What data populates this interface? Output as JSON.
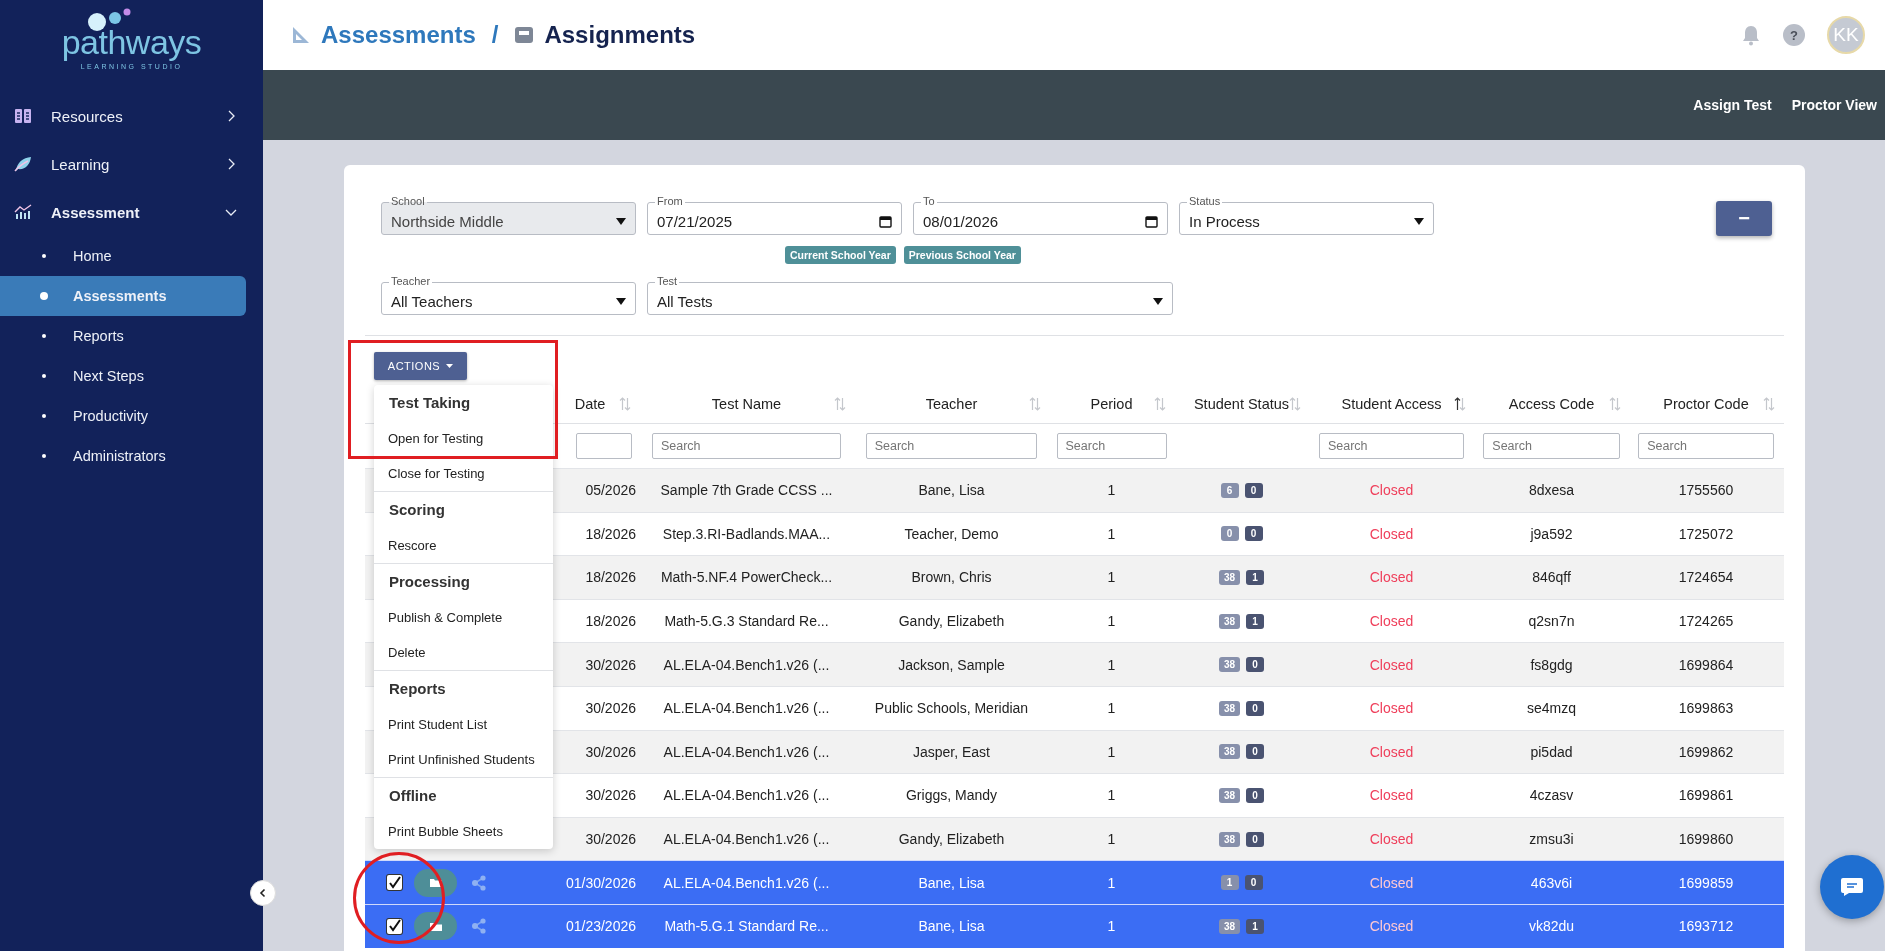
{
  "sidebar": {
    "logo": {
      "name": "pathways",
      "tagline": "LEARNING STUDIO"
    },
    "items": [
      {
        "label": "Resources",
        "kind": "book",
        "expanded": false
      },
      {
        "label": "Learning",
        "kind": "leaf",
        "expanded": false
      },
      {
        "label": "Assessment",
        "kind": "chart",
        "expanded": true,
        "children": [
          {
            "label": "Home",
            "selected": false
          },
          {
            "label": "Assessments",
            "selected": true
          },
          {
            "label": "Reports",
            "selected": false
          },
          {
            "label": "Next Steps",
            "selected": false
          },
          {
            "label": "Productivity",
            "selected": false
          },
          {
            "label": "Administrators",
            "selected": false
          }
        ]
      }
    ]
  },
  "header": {
    "breadcrumb": [
      {
        "label": "Assessments",
        "kind": "link"
      },
      {
        "label": "Assignments",
        "kind": "current"
      }
    ],
    "separator": "/",
    "help": "?",
    "avatar": "KK"
  },
  "toolbar": {
    "links": [
      "Assign Test",
      "Proctor View"
    ]
  },
  "filters": {
    "row_1": [
      {
        "label": "School",
        "value": "Northside Middle",
        "kind": "select",
        "disabled": true
      },
      {
        "label": "From",
        "value": "07/21/2025",
        "kind": "date",
        "disabled": false
      },
      {
        "label": "To",
        "value": "08/01/2026",
        "kind": "date",
        "disabled": false
      },
      {
        "label": "Status",
        "value": "In Process",
        "kind": "select",
        "disabled": false
      }
    ],
    "chips": [
      "Current School Year",
      "Previous School Year"
    ],
    "row_2": [
      {
        "label": "Teacher",
        "value": "All Teachers",
        "kind": "select",
        "disabled": false
      },
      {
        "label": "Test",
        "value": "All Tests",
        "kind": "select",
        "disabled": false
      }
    ],
    "collapse_button": "−"
  },
  "actions_menu": {
    "button": "ACTIONS",
    "groups": [
      {
        "title": "Test Taking",
        "items": [
          "Open for Testing",
          "Close for Testing"
        ]
      },
      {
        "title": "Scoring",
        "items": [
          "Rescore"
        ]
      },
      {
        "title": "Processing",
        "items": [
          "Publish & Complete",
          "Delete"
        ]
      },
      {
        "title": "Reports",
        "items": [
          "Print Student List",
          "Print Unfinished Students"
        ]
      },
      {
        "title": "Offline",
        "items": [
          "Print Bubble Sheets"
        ]
      }
    ]
  },
  "table": {
    "columns": [
      {
        "label": "Date",
        "sorted": false,
        "has_search": true
      },
      {
        "label": "Test Name",
        "sorted": false,
        "has_search": true,
        "placeholder": "Search"
      },
      {
        "label": "Teacher",
        "sorted": false,
        "has_search": true,
        "placeholder": "Search"
      },
      {
        "label": "Period",
        "sorted": false,
        "has_search": true,
        "placeholder": "Search"
      },
      {
        "label": "Student Status",
        "sorted": false,
        "has_search": false
      },
      {
        "label": "Student Access",
        "sorted": true,
        "has_search": true,
        "placeholder": "Search"
      },
      {
        "label": "Access Code",
        "sorted": false,
        "has_search": true,
        "placeholder": "Search"
      },
      {
        "label": "Proctor Code",
        "sorted": false,
        "has_search": true,
        "placeholder": "Search"
      }
    ],
    "rows": [
      {
        "selected": false,
        "date": "05/2026",
        "test_name": "Sample 7th Grade CCSS ...",
        "teacher": "Bane, Lisa",
        "period": "1",
        "counts": [
          "6",
          "0"
        ],
        "access": "Closed",
        "access_code": "8dxesa",
        "proctor_code": "1755560"
      },
      {
        "selected": false,
        "date": "18/2026",
        "test_name": "Step.3.RI-Badlands.MAA...",
        "teacher": "Teacher, Demo",
        "period": "1",
        "counts": [
          "0",
          "0"
        ],
        "access": "Closed",
        "access_code": "j9a592",
        "proctor_code": "1725072"
      },
      {
        "selected": false,
        "date": "18/2026",
        "test_name": "Math-5.NF.4 PowerCheck...",
        "teacher": "Brown, Chris",
        "period": "1",
        "counts": [
          "38",
          "1"
        ],
        "access": "Closed",
        "access_code": "846qff",
        "proctor_code": "1724654"
      },
      {
        "selected": false,
        "date": "18/2026",
        "test_name": "Math-5.G.3 Standard Re...",
        "teacher": "Gandy, Elizabeth",
        "period": "1",
        "counts": [
          "38",
          "1"
        ],
        "access": "Closed",
        "access_code": "q2sn7n",
        "proctor_code": "1724265"
      },
      {
        "selected": false,
        "date": "30/2026",
        "test_name": "AL.ELA-04.Bench1.v26 (...",
        "teacher": "Jackson, Sample",
        "period": "1",
        "counts": [
          "38",
          "0"
        ],
        "access": "Closed",
        "access_code": "fs8gdg",
        "proctor_code": "1699864"
      },
      {
        "selected": false,
        "date": "30/2026",
        "test_name": "AL.ELA-04.Bench1.v26 (...",
        "teacher": "Public Schools, Meridian",
        "period": "1",
        "counts": [
          "38",
          "0"
        ],
        "access": "Closed",
        "access_code": "se4mzq",
        "proctor_code": "1699863"
      },
      {
        "selected": false,
        "date": "30/2026",
        "test_name": "AL.ELA-04.Bench1.v26 (...",
        "teacher": "Jasper, East",
        "period": "1",
        "counts": [
          "38",
          "0"
        ],
        "access": "Closed",
        "access_code": "pi5dad",
        "proctor_code": "1699862"
      },
      {
        "selected": false,
        "date": "30/2026",
        "test_name": "AL.ELA-04.Bench1.v26 (...",
        "teacher": "Griggs, Mandy",
        "period": "1",
        "counts": [
          "38",
          "0"
        ],
        "access": "Closed",
        "access_code": "4czasv",
        "proctor_code": "1699861"
      },
      {
        "selected": false,
        "date": "30/2026",
        "test_name": "AL.ELA-04.Bench1.v26 (...",
        "teacher": "Gandy, Elizabeth",
        "period": "1",
        "counts": [
          "38",
          "0"
        ],
        "access": "Closed",
        "access_code": "zmsu3i",
        "proctor_code": "1699860"
      },
      {
        "selected": true,
        "checked": true,
        "date": "01/30/2026",
        "test_name": "AL.ELA-04.Bench1.v26 (...",
        "teacher": "Bane, Lisa",
        "period": "1",
        "counts": [
          "1",
          "0"
        ],
        "access": "Closed",
        "access_code": "463v6i",
        "proctor_code": "1699859"
      },
      {
        "selected": true,
        "checked": true,
        "date": "01/23/2026",
        "test_name": "Math-5.G.1 Standard Re...",
        "teacher": "Bane, Lisa",
        "period": "1",
        "counts": [
          "38",
          "1"
        ],
        "access": "Closed",
        "access_code": "vk82du",
        "proctor_code": "1693712"
      }
    ]
  },
  "annotations": [
    {
      "kind": "frame"
    },
    {
      "kind": "circle"
    }
  ]
}
